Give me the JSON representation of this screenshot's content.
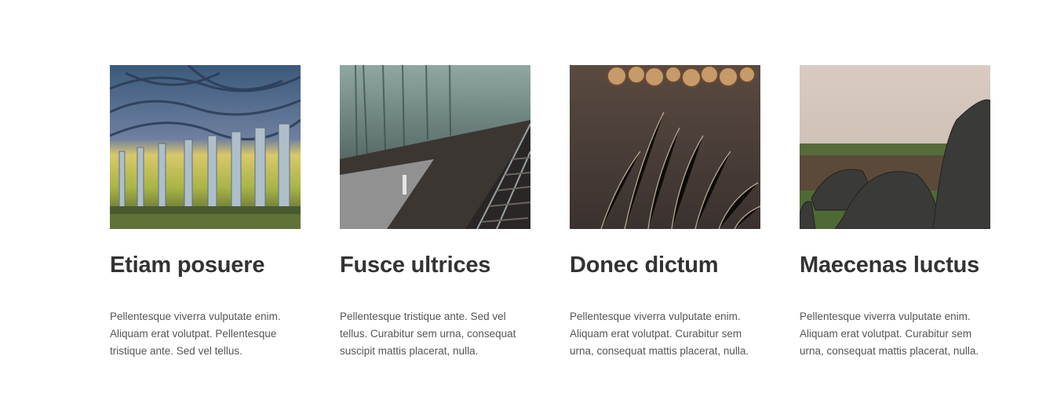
{
  "cards": [
    {
      "title": "Etiam posuere",
      "description": "Pellentesque viverra vulputate enim. Aliquam erat volutpat. Pellentesque tristique ante. Sed vel tellus.",
      "image": "tree-alley-photo"
    },
    {
      "title": "Fusce ultrices",
      "description": "Pellentesque tristique ante. Sed vel tellus. Curabitur sem urna, consequat suscipit mattis placerat, nulla.",
      "image": "foggy-railway-photo"
    },
    {
      "title": "Donec dictum",
      "description": "Pellentesque viverra vulputate enim. Aliquam erat volutpat. Curabitur sem urna, consequat mattis placerat, nulla.",
      "image": "logs-dry-grass-photo"
    },
    {
      "title": "Maecenas luctus",
      "description": "Pellentesque viverra vulputate enim. Aliquam erat volutpat. Curabitur sem urna, consequat mattis placerat, nulla.",
      "image": "boulders-field-photo"
    }
  ],
  "colors": {
    "heading": "#333333",
    "body_text": "#555555",
    "background": "#ffffff"
  }
}
